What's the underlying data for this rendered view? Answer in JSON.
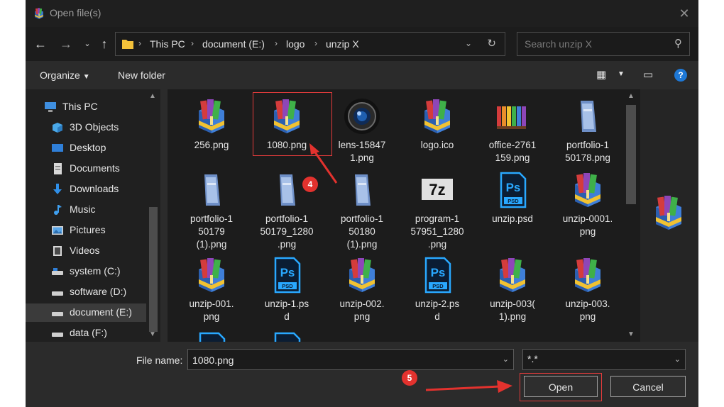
{
  "window": {
    "title": "Open file(s)"
  },
  "nav": {
    "breadcrumb": [
      "This PC",
      "document (E:)",
      "logo",
      "unzip X"
    ],
    "search_placeholder": "Search unzip X"
  },
  "toolbar": {
    "organize": "Organize",
    "new_folder": "New folder",
    "help": "?"
  },
  "sidebar": {
    "items": [
      {
        "label": "This PC",
        "icon": "pc-icon"
      },
      {
        "label": "3D Objects",
        "icon": "cube-icon"
      },
      {
        "label": "Desktop",
        "icon": "desktop-icon"
      },
      {
        "label": "Documents",
        "icon": "documents-icon"
      },
      {
        "label": "Downloads",
        "icon": "download-icon"
      },
      {
        "label": "Music",
        "icon": "music-icon"
      },
      {
        "label": "Pictures",
        "icon": "pictures-icon"
      },
      {
        "label": "Videos",
        "icon": "videos-icon"
      },
      {
        "label": "system (C:)",
        "icon": "drive-icon"
      },
      {
        "label": "software (D:)",
        "icon": "drive-icon"
      },
      {
        "label": "document (E:)",
        "icon": "drive-icon"
      },
      {
        "label": "data (F:)",
        "icon": "drive-icon"
      }
    ],
    "selected": "document (E:)"
  },
  "files": [
    {
      "label": "256.png",
      "icon": "archive-icon"
    },
    {
      "label": "1080.png",
      "icon": "archive-icon",
      "selected": true
    },
    {
      "label": "lens-15847\n1.png",
      "icon": "lens-icon"
    },
    {
      "label": "logo.ico",
      "icon": "archive-icon"
    },
    {
      "label": "office-2761\n159.png",
      "icon": "binders-icon"
    },
    {
      "label": "portfolio-1\n50178.png",
      "icon": "portfolio-icon"
    },
    {
      "label": "portfolio-1\n50179\n(1).png",
      "icon": "portfolio-icon"
    },
    {
      "label": "portfolio-1\n50179_1280\n.png",
      "icon": "portfolio-icon"
    },
    {
      "label": "portfolio-1\n50180\n(1).png",
      "icon": "portfolio-icon"
    },
    {
      "label": "program-1\n57951_1280\n.png",
      "icon": "7z-icon"
    },
    {
      "label": "unzip.psd",
      "icon": "psd-icon"
    },
    {
      "label": "unzip-0001.\npng",
      "icon": "archive-icon"
    },
    {
      "label": "unzip-001.\npng",
      "icon": "archive-icon"
    },
    {
      "label": "unzip-1.ps\nd",
      "icon": "psd-icon"
    },
    {
      "label": "unzip-002.\npng",
      "icon": "archive-icon"
    },
    {
      "label": "unzip-2.ps\nd",
      "icon": "psd-icon"
    },
    {
      "label": "unzip-003(\n1).png",
      "icon": "archive-icon"
    },
    {
      "label": "unzip-003.\npng",
      "icon": "archive-icon"
    }
  ],
  "bottom": {
    "file_name_label": "File name:",
    "file_name_value": "1080.png",
    "filter_value": "*.*",
    "open": "Open",
    "cancel": "Cancel"
  },
  "annotations": {
    "step4": "4",
    "step5": "5"
  },
  "colors": {
    "accent_red": "#e3322e",
    "help_blue": "#1e78d6"
  }
}
